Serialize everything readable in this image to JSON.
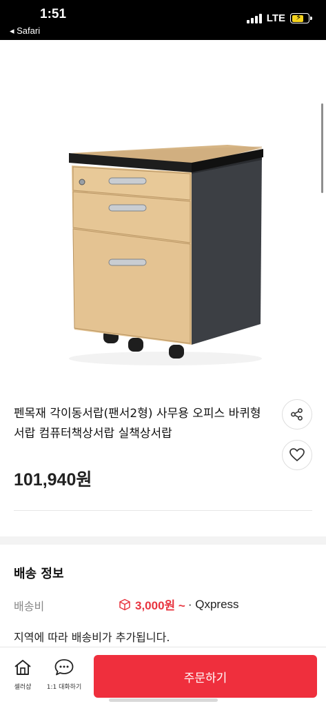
{
  "status_bar": {
    "time": "1:51",
    "back_label": "◂ Safari",
    "network": "LTE"
  },
  "product": {
    "image_icon": "mobile-drawer-cabinet-image",
    "title": "펜목재 각이동서랍(팬서2형) 사무용 오피스 바퀴형서랍 컴퓨터책상서랍 실책상서랍",
    "price": "101,940원",
    "share_icon": "share-icon",
    "like_icon": "heart-icon"
  },
  "shipping": {
    "title": "배송 정보",
    "fee_label": "배송비",
    "fee_icon": "box-icon",
    "fee_value": "3,000원 ~",
    "company": "· Qxpress",
    "note": "지역에 따라 배송비가 추가됩니다."
  },
  "bottom_bar": {
    "shop_label": "셀러샵",
    "shop_icon": "home-icon",
    "chat_label": "1:1 대화하기",
    "chat_icon": "chat-bubble-icon",
    "order_label": "주문하기"
  },
  "colors": {
    "accent": "#ef2f3d",
    "fee_red": "#e8343f",
    "battery": "#f5d31c"
  }
}
